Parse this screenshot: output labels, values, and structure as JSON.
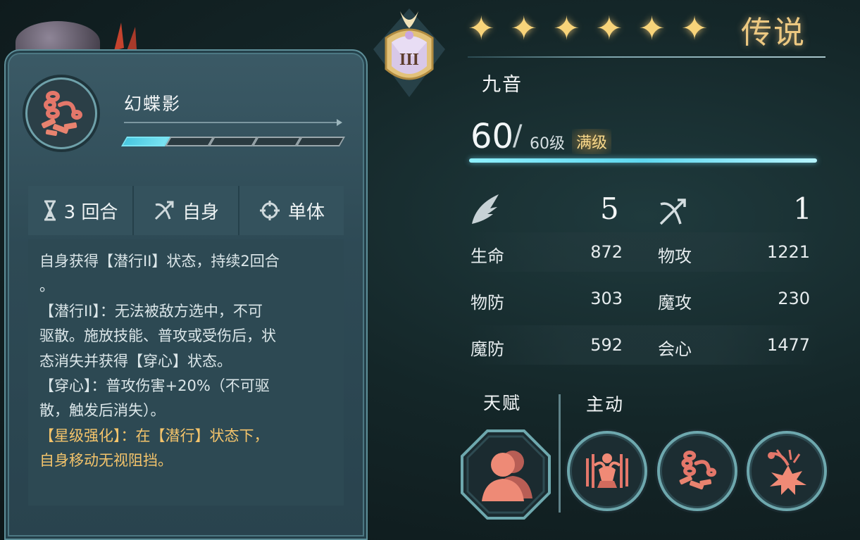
{
  "skill_card": {
    "name": "幻蝶影",
    "level_filled": 1,
    "level_total": 5,
    "tags": [
      {
        "icon": "hourglass-icon",
        "label": "3 回合"
      },
      {
        "icon": "bow-icon",
        "label": "自身"
      },
      {
        "icon": "crosshair-icon",
        "label": "单体"
      }
    ],
    "desc_lines": [
      "自身获得【潜行II】状态，持续2回合",
      "。",
      "【潜行II】：无法被敌方选中，不可",
      "驱散。施放技能、普攻或受伤后，状",
      "态消失并获得【穿心】状态。",
      "【穿心】：普攻伤害+20%（不可驱",
      "散，触发后消失）。"
    ],
    "desc_gold_lines": [
      "【星级强化】：在【潜行】状态下，",
      "自身移动无视阻挡。"
    ]
  },
  "hero": {
    "emblem_numeral": "III",
    "stars": 6,
    "rarity": "传说",
    "name": "九音",
    "level_current": "60",
    "level_slash": "/",
    "level_max": "60级",
    "level_badge": "满级",
    "level_progress": 1.0,
    "top_stats": [
      {
        "icon": "wing-icon",
        "value": "5"
      },
      {
        "icon": "bow-icon",
        "value": "1"
      }
    ],
    "stats": [
      {
        "l1": "生命",
        "v1": "872",
        "l2": "物攻",
        "v2": "1221"
      },
      {
        "l1": "物防",
        "v1": "303",
        "l2": "魔攻",
        "v2": "230"
      },
      {
        "l1": "魔防",
        "v1": "592",
        "l2": "会心",
        "v2": "1477"
      }
    ],
    "talent_label": "天赋",
    "active_label": "主动"
  },
  "colors": {
    "accent_cyan": "#5fd8ef",
    "gold": "#f4c46b",
    "skill_red": "#e4776a"
  }
}
